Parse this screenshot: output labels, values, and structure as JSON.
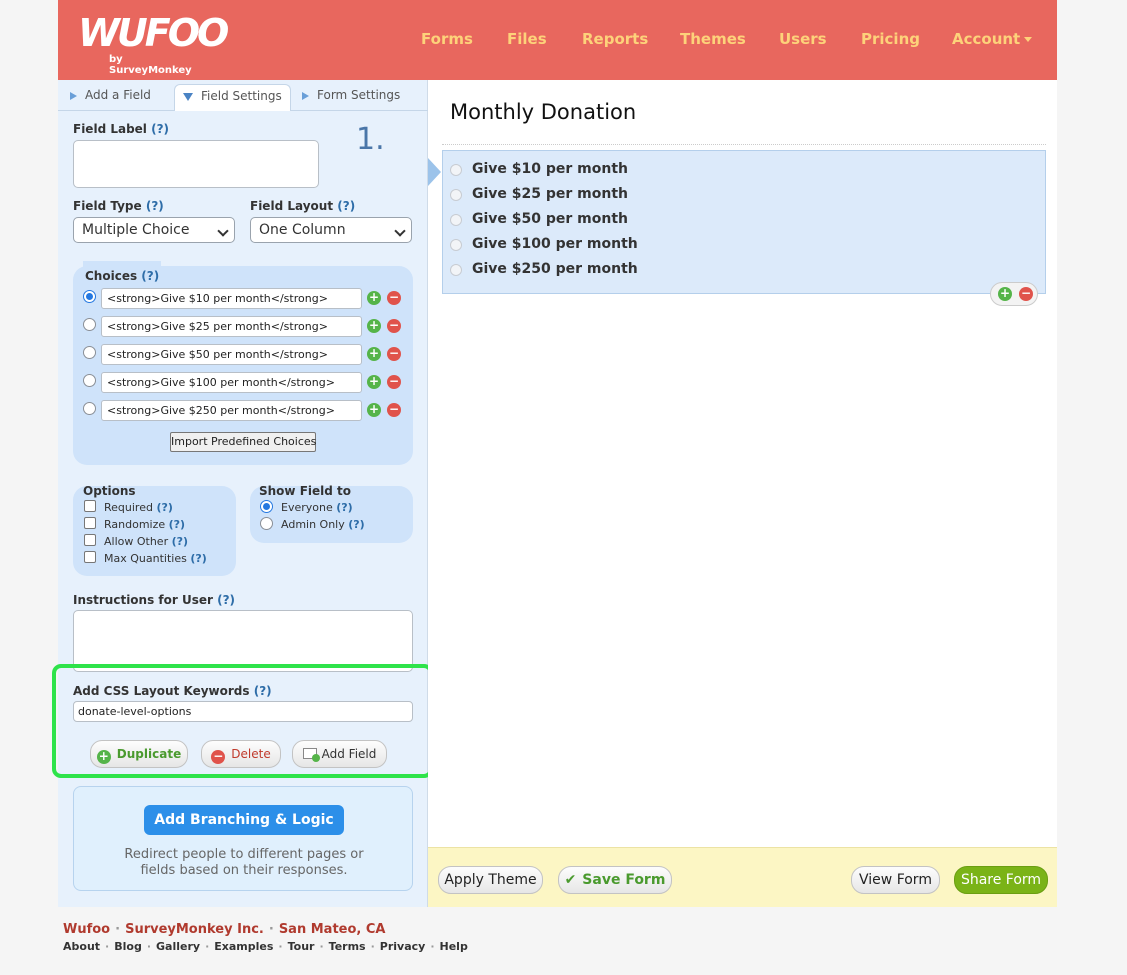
{
  "header": {
    "logo_text": "WUFOO",
    "logo_sub": "by SurveyMonkey",
    "nav": [
      "Forms",
      "Files",
      "Reports",
      "Themes",
      "Users",
      "Pricing",
      "Account"
    ]
  },
  "tabs": {
    "add_field": "Add a Field",
    "field_settings": "Field Settings",
    "form_settings": "Form Settings"
  },
  "field_settings": {
    "field_label": "Field Label",
    "help": "(?)",
    "step_marker": "1.",
    "field_type_label": "Field Type",
    "field_type_value": "Multiple Choice",
    "field_layout_label": "Field Layout",
    "field_layout_value": "One Column",
    "choices_label": "Choices",
    "choices": [
      "<strong>Give $10 per month</strong>",
      "<strong>Give $25 per month</strong>",
      "<strong>Give $50 per month</strong>",
      "<strong>Give $100 per month</strong>",
      "<strong>Give $250 per month</strong>"
    ],
    "import_button": "Import Predefined Choices",
    "options_label": "Options",
    "options": [
      "Required",
      "Randomize",
      "Allow Other",
      "Max Quantities"
    ],
    "show_field_label": "Show Field to",
    "show_field_options": [
      "Everyone",
      "Admin Only"
    ],
    "instructions_label": "Instructions for User",
    "css_label": "Add CSS Layout Keywords",
    "css_value": "donate-level-options",
    "duplicate_button": "Duplicate",
    "delete_button": "Delete",
    "add_field_button": "Add Field",
    "branching_button": "Add Branching & Logic",
    "branching_text_1": "Redirect people to different pages or",
    "branching_text_2": "fields based on their responses."
  },
  "form": {
    "title": "Monthly Donation",
    "choices": [
      "Give $10 per month",
      "Give $25 per month",
      "Give $50 per month",
      "Give $100 per month",
      "Give $250 per month"
    ]
  },
  "bottom_bar": {
    "apply_theme": "Apply Theme",
    "save_form": "Save Form",
    "view_form": "View Form",
    "share_form": "Share Form"
  },
  "footer": {
    "line1": [
      "Wufoo",
      "SurveyMonkey Inc.",
      "San Mateo, CA"
    ],
    "links": [
      "About",
      "Blog",
      "Gallery",
      "Examples",
      "Tour",
      "Terms",
      "Privacy",
      "Help"
    ]
  },
  "colors": {
    "header": "#e8675e",
    "nav_text": "#fdd27a",
    "highlight_box": "#2ee34a",
    "primary_blue": "#2c8fe9",
    "share_green": "#7ab317"
  }
}
